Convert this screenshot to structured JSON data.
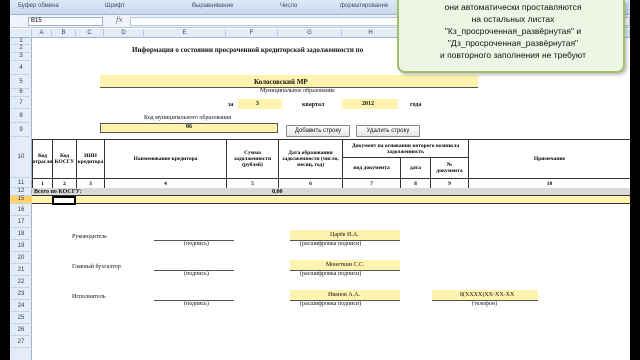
{
  "ribbon": {
    "groups": [
      "Буфер обмена",
      "Шрифт",
      "Выравнивание",
      "Число",
      "форматирование"
    ]
  },
  "formula_bar": {
    "name_box": "B15",
    "fx": "fx",
    "formula": ""
  },
  "columns": [
    "A",
    "B",
    "C",
    "D",
    "E",
    "F",
    "G",
    "H",
    "I",
    "J",
    "K"
  ],
  "rows": [
    "1",
    "2",
    "3",
    "4",
    "5",
    "6",
    "7",
    "8",
    "9",
    "10",
    "11",
    "12",
    "13",
    "15",
    "16",
    "17",
    "18",
    "19",
    "20",
    "21",
    "22",
    "23",
    "24",
    "25",
    "26",
    "27"
  ],
  "sheet": {
    "title": "Информация о состоянии просроченной кредиторской задолженности по",
    "municipality": "Колосовский МР",
    "municipality_caption": "Муниципальное образование",
    "period_for": "за",
    "period_num": "3",
    "period_quarter": "квартал",
    "period_year": "2012",
    "period_year_label": "года",
    "code_caption": "Код муниципального образования",
    "code_value": "06",
    "add_row_button": "Добавить строку",
    "delete_row_button": "Удалить строку",
    "table_headers": {
      "code_dept": "Код отрасли",
      "code_kosgu": "Код КОСГУ",
      "inn": "ИНН кредитора",
      "creditor_name": "Наименование кредитора",
      "amount": "Сумма задолженности (рублей)",
      "formation_date": "Дата образования задолженности (число, месяц, год)",
      "doc_group": "Документ на основании которого возникла задолженность",
      "doc_type": "вид документа",
      "doc_date": "дата",
      "doc_no": "№ документа",
      "note": "Примечание"
    },
    "column_numbers": [
      "1",
      "2",
      "3",
      "4",
      "5",
      "6",
      "7",
      "8",
      "9",
      "10"
    ],
    "total_label": "Всего по КОСГУ:",
    "total_value": "0,00",
    "head_label": "Руководитель",
    "head_name": "Царёв И.А.",
    "signature_caption": "(подпись)",
    "decoding_caption": "(расшифровка подписи)",
    "accountant_label": "Главный бухгалтер",
    "accountant_name": "Монеткин С.С.",
    "executor_label": "Исполнитель",
    "executor_name": "Иванов А.А.",
    "phone_value": "8(XXXX)XX-XX-XX",
    "phone_caption": "(телефон)"
  },
  "note": {
    "lines": [
      "они автоматически проставляются",
      "на остальных листах",
      "\"Кз_просроченная_развёрнутая\" и",
      "\"Дз_просроченная_развёрнутая\"",
      "и повторного заполнения не требуют"
    ]
  }
}
